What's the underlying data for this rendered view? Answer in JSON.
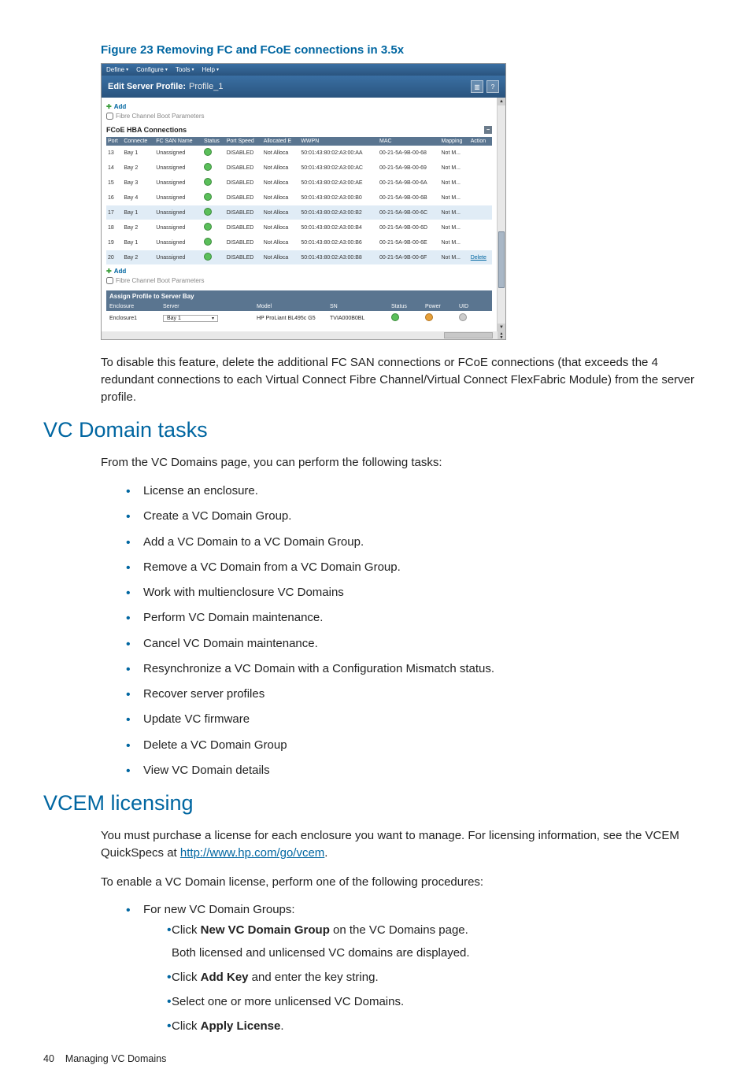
{
  "figure": {
    "caption": "Figure 23 Removing FC and FCoE connections in 3.5x"
  },
  "screenshot": {
    "menubar": [
      "Define",
      "Configure",
      "Tools",
      "Help"
    ],
    "title_label": "Edit Server Profile:",
    "title_value": "Profile_1",
    "help_icon": "?",
    "add_label": "Add",
    "fc_boot_label": "Fibre Channel Boot Parameters",
    "section_label": "FCoE HBA Connections",
    "columns": [
      "Port",
      "Connecte",
      "FC SAN Name",
      "Status",
      "Port Speed",
      "Allocated E",
      "WWPN",
      "MAC",
      "Mapping",
      "Action"
    ],
    "rows": [
      {
        "port": "13",
        "bay": "Bay 1",
        "san": "Unassigned",
        "speed": "DISABLED",
        "alloc": "Not Alloca",
        "wwpn": "50:01:43:80:02:A3:00:AA",
        "mac": "00-21-5A-9B-00-68",
        "mapping": "Not M...",
        "action": "",
        "hl": false
      },
      {
        "port": "14",
        "bay": "Bay 2",
        "san": "Unassigned",
        "speed": "DISABLED",
        "alloc": "Not Alloca",
        "wwpn": "50:01:43:80:02:A3:00:AC",
        "mac": "00-21-5A-9B-00-69",
        "mapping": "Not M...",
        "action": "",
        "hl": false
      },
      {
        "port": "15",
        "bay": "Bay 3",
        "san": "Unassigned",
        "speed": "DISABLED",
        "alloc": "Not Alloca",
        "wwpn": "50:01:43:80:02:A3:00:AE",
        "mac": "00-21-5A-9B-00-6A",
        "mapping": "Not M...",
        "action": "",
        "hl": false
      },
      {
        "port": "16",
        "bay": "Bay 4",
        "san": "Unassigned",
        "speed": "DISABLED",
        "alloc": "Not Alloca",
        "wwpn": "50:01:43:80:02:A3:00:B0",
        "mac": "00-21-5A-9B-00-6B",
        "mapping": "Not M...",
        "action": "",
        "hl": false
      },
      {
        "port": "17",
        "bay": "Bay 1",
        "san": "Unassigned",
        "speed": "DISABLED",
        "alloc": "Not Alloca",
        "wwpn": "50:01:43:80:02:A3:00:B2",
        "mac": "00-21-5A-9B-00-6C",
        "mapping": "Not M...",
        "action": "",
        "hl": true
      },
      {
        "port": "18",
        "bay": "Bay 2",
        "san": "Unassigned",
        "speed": "DISABLED",
        "alloc": "Not Alloca",
        "wwpn": "50:01:43:80:02:A3:00:B4",
        "mac": "00-21-5A-9B-00-6D",
        "mapping": "Not M...",
        "action": "",
        "hl": false
      },
      {
        "port": "19",
        "bay": "Bay 1",
        "san": "Unassigned",
        "speed": "DISABLED",
        "alloc": "Not Alloca",
        "wwpn": "50:01:43:80:02:A3:00:B6",
        "mac": "00-21-5A-9B-00-6E",
        "mapping": "Not M...",
        "action": "",
        "hl": false
      },
      {
        "port": "20",
        "bay": "Bay 2",
        "san": "Unassigned",
        "speed": "DISABLED",
        "alloc": "Not Alloca",
        "wwpn": "50:01:43:80:02:A3:00:B8",
        "mac": "00-21-5A-9B-00-6F",
        "mapping": "Not M...",
        "action": "Delete",
        "hl": true
      }
    ],
    "assign_header": "Assign Profile to Server Bay",
    "assign_columns": [
      "Enclosure",
      "Server",
      "",
      "Model",
      "SN",
      "Status",
      "Power",
      "UID"
    ],
    "assign_row": {
      "enclosure": "Enclosure1",
      "server": "Bay 1",
      "model": "HP ProLiant BL495c G5",
      "sn": "TVIA000B0BL"
    },
    "fc_boot_label2": "Fibre Channel Boot Parameters"
  },
  "para1": "To disable this feature, delete the additional FC SAN connections or FCoE connections (that exceeds the 4 redundant connections to each Virtual Connect Fibre Channel/Virtual Connect FlexFabric Module) from the server profile.",
  "h_vcdomain": "VC Domain tasks",
  "vcdomain_intro": "From the VC Domains page, you can perform the following tasks:",
  "vcdomain_tasks": [
    "License an enclosure.",
    "Create a VC Domain Group.",
    "Add a VC Domain to a VC Domain Group.",
    "Remove a VC Domain from a VC Domain Group.",
    "Work with multienclosure VC Domains",
    "Perform VC Domain maintenance.",
    "Cancel VC Domain maintenance.",
    "Resynchronize a VC Domain with a Configuration Mismatch status.",
    "Recover server profiles",
    "Update VC firmware",
    "Delete a VC Domain Group",
    "View VC Domain details"
  ],
  "h_licensing": "VCEM licensing",
  "lic_p1_a": "You must purchase a license for each enclosure you want to manage. For licensing information, see the VCEM QuickSpecs at ",
  "lic_link": "http://www.hp.com/go/vcem",
  "lic_p1_b": ".",
  "lic_p2": "To enable a VC Domain license, perform one of the following procedures:",
  "lic_bullet1": "For new VC Domain Groups:",
  "lic_steps": {
    "s1a": "Click ",
    "s1b": "New VC Domain Group",
    "s1c": " on the VC Domains page.",
    "s1_sub": "Both licensed and unlicensed VC domains are displayed.",
    "s2a": "Click ",
    "s2b": "Add Key",
    "s2c": " and enter the key string.",
    "s3": "Select one or more unlicensed VC Domains.",
    "s4a": "Click ",
    "s4b": "Apply License",
    "s4c": "."
  },
  "footer_page": "40",
  "footer_text": "Managing VC Domains"
}
